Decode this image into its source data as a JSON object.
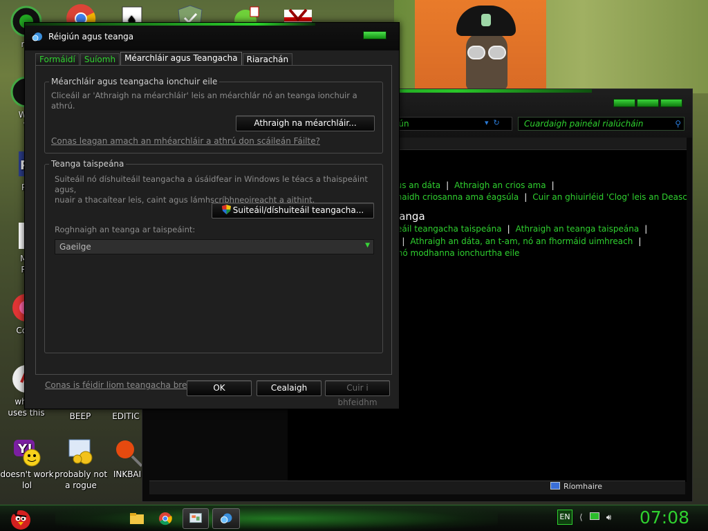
{
  "desktop": {
    "icons": [
      {
        "label": "mi",
        "name": "desktop-icon-mi"
      },
      {
        "label": "Win\nV",
        "name": "desktop-icon-win"
      },
      {
        "label": "Po",
        "name": "desktop-icon-po"
      },
      {
        "label": "Mo\nRe",
        "name": "desktop-icon-mo"
      },
      {
        "label": "Cock",
        "name": "desktop-icon-cock"
      },
      {
        "label": "who t\nuses this",
        "name": "desktop-icon-who"
      },
      {
        "label": "BEEP",
        "name": "desktop-icon-beep"
      },
      {
        "label": "EDITIC",
        "name": "desktop-icon-edition"
      },
      {
        "label": "doesn't work\nlol",
        "name": "desktop-icon-yahoo"
      },
      {
        "label": "probably not\na rogue",
        "name": "desktop-icon-rogue"
      },
      {
        "label": "INKBAI",
        "name": "desktop-icon-inkball"
      }
    ]
  },
  "control_panel": {
    "address_text": "iún",
    "search_placeholder": "Cuardaigh painéal rialúcháin",
    "row1": [
      "gus an dáta",
      "Athraigh an crios ama"
    ],
    "row2": [
      "ghaidh criosanna ama éagsúla",
      "Cuir an ghiuirléid 'Clog' leis an Deasc"
    ],
    "heading": "eanga",
    "row3": [
      "iteáil teangacha taispeána",
      "Athraigh an teanga taispeána"
    ],
    "row4": [
      "a",
      "Athraigh an dáta, an t-am, nó an fhormáid uimhreach"
    ],
    "row5": "r nó modhanna ionchurtha eile",
    "status_computer": "Ríomhaire"
  },
  "dialog": {
    "title": "Réigiún agus teanga",
    "tabs": [
      "Formáidí",
      "Suíomh",
      "Méarchláir agus Teangacha",
      "Riarachán"
    ],
    "group1": {
      "legend": "Méarchláir agus teangacha ionchuir eile",
      "desc": "Cliceáil ar 'Athraigh na méarchláir' leis an méarchlár nó an teanga ionchuir a athrú.",
      "button": "Athraigh na méarchláir...",
      "link": "Conas leagan amach an mhéarchláir a athrú don scáileán Fáilte?"
    },
    "group2": {
      "legend": "Teanga taispeána",
      "desc_line1": "Suiteáil nó díshuiteáil teangacha a úsáidfear in Windows le téacs a thaispeáint agus,",
      "desc_line2": "nuair a thacaítear leis, caint agus lámhscríbhneoireacht a aithint.",
      "button": "Suiteáil/díshuiteáil teangacha...",
      "select_label": "Roghnaigh an teanga ar taispeáint:",
      "select_value": "Gaeilge"
    },
    "bottom_link": "Conas is féidir liom teangacha breise a shuiteáil?",
    "ok": "OK",
    "cancel": "Cealaigh",
    "apply": "Cuir i bhfeidhm"
  },
  "taskbar": {
    "language": "EN",
    "clock": "07:08"
  }
}
